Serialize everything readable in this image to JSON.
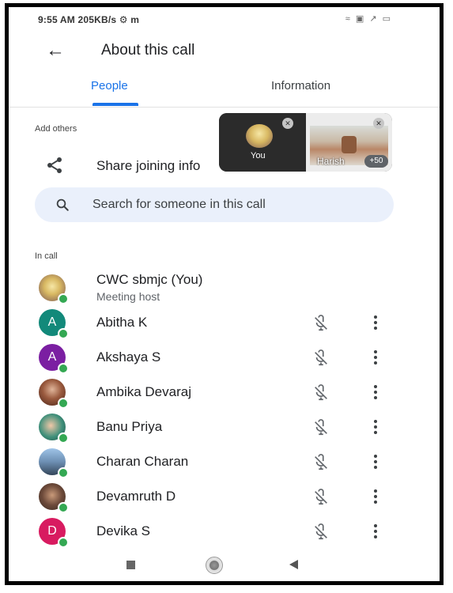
{
  "status_bar": {
    "left_text": "9:55 AM  205KB/s ⚙ m",
    "right_text": "≈ ▣ ↗ ▭"
  },
  "app_bar": {
    "back_label": "←",
    "title": "About this call"
  },
  "tabs": [
    {
      "label": "People",
      "selected": true
    },
    {
      "label": "Information",
      "selected": false
    }
  ],
  "add_others": {
    "section_label": "Add others",
    "share_label": "Share joining info"
  },
  "search": {
    "placeholder": "Search for someone in this call"
  },
  "pip": {
    "you_label": "You",
    "other_name": "Harish",
    "extra_count": "+50"
  },
  "in_call": {
    "section_label": "In call",
    "participants": [
      {
        "name": "CWC sbmjc (You)",
        "subtitle": "Meeting host",
        "avatar_letter": "",
        "avatar_color": "#e8d8a0",
        "avatar_type": "logo"
      },
      {
        "name": "Abitha K",
        "subtitle": "",
        "avatar_letter": "A",
        "avatar_color": "#12897a",
        "avatar_type": "letter"
      },
      {
        "name": "Akshaya S",
        "subtitle": "",
        "avatar_letter": "A",
        "avatar_color": "#7b1fa2",
        "avatar_type": "letter"
      },
      {
        "name": "Ambika Devaraj",
        "subtitle": "",
        "avatar_letter": "",
        "avatar_color": "#6b3b2a",
        "avatar_type": "photo"
      },
      {
        "name": "Banu Priya",
        "subtitle": "",
        "avatar_letter": "",
        "avatar_color": "#3f8f7a",
        "avatar_type": "photo"
      },
      {
        "name": "Charan Charan",
        "subtitle": "",
        "avatar_letter": "",
        "avatar_color": "#4a6a8a",
        "avatar_type": "photo"
      },
      {
        "name": "Devamruth D",
        "subtitle": "",
        "avatar_letter": "",
        "avatar_color": "#6d4a3a",
        "avatar_type": "photo"
      },
      {
        "name": "Devika S",
        "subtitle": "",
        "avatar_letter": "D",
        "avatar_color": "#d81b60",
        "avatar_type": "letter"
      }
    ]
  },
  "colors": {
    "accent": "#1a73e8",
    "presence": "#34a853",
    "search_bg": "#eaf0fb"
  }
}
